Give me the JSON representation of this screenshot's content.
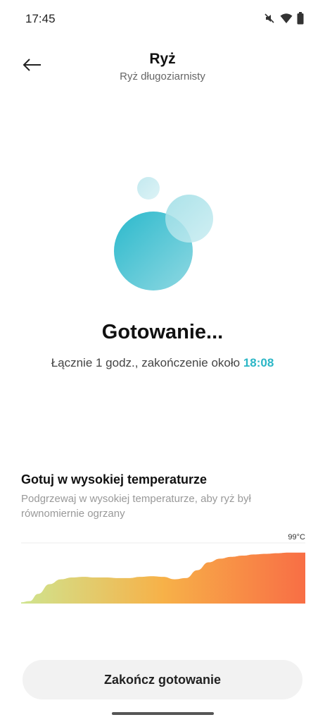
{
  "status_bar": {
    "time": "17:45",
    "icons": [
      "mute-icon",
      "wifi-icon",
      "battery-icon"
    ]
  },
  "header": {
    "title": "Ryż",
    "subtitle": "Ryż długoziarnisty",
    "back_icon": "arrow-left-icon"
  },
  "cooking": {
    "heading": "Gotowanie...",
    "summary_prefix": "Łącznie 1 godz., zakończenie około ",
    "end_time": "18:08"
  },
  "phase": {
    "title": "Gotuj w wysokiej temperaturze",
    "description": "Podgrzewaj w wysokiej temperaturze, aby ryż był równomiernie ogrzany",
    "max_temperature_label": "99°C"
  },
  "chart_data": {
    "type": "area",
    "title": "",
    "xlabel": "",
    "ylabel": "",
    "ylim": [
      0,
      100
    ],
    "x": [
      0,
      3,
      6,
      10,
      14,
      18,
      22,
      26,
      30,
      34,
      38,
      42,
      46,
      50,
      54,
      58,
      62,
      66,
      70,
      74,
      78,
      82,
      86,
      90,
      94,
      100
    ],
    "values": [
      2,
      4,
      16,
      32,
      40,
      43,
      44,
      43,
      43,
      42,
      42,
      44,
      45,
      44,
      40,
      42,
      55,
      68,
      74,
      77,
      79,
      81,
      82,
      83,
      84,
      84
    ],
    "annotations": [
      "99°C"
    ],
    "gradient_colors": [
      "#cfe48f",
      "#f7b148",
      "#f86e45"
    ],
    "grid": false
  },
  "actions": {
    "finish_label": "Zakończ gotowanie"
  },
  "colors": {
    "accent": "#2bb6c6"
  }
}
